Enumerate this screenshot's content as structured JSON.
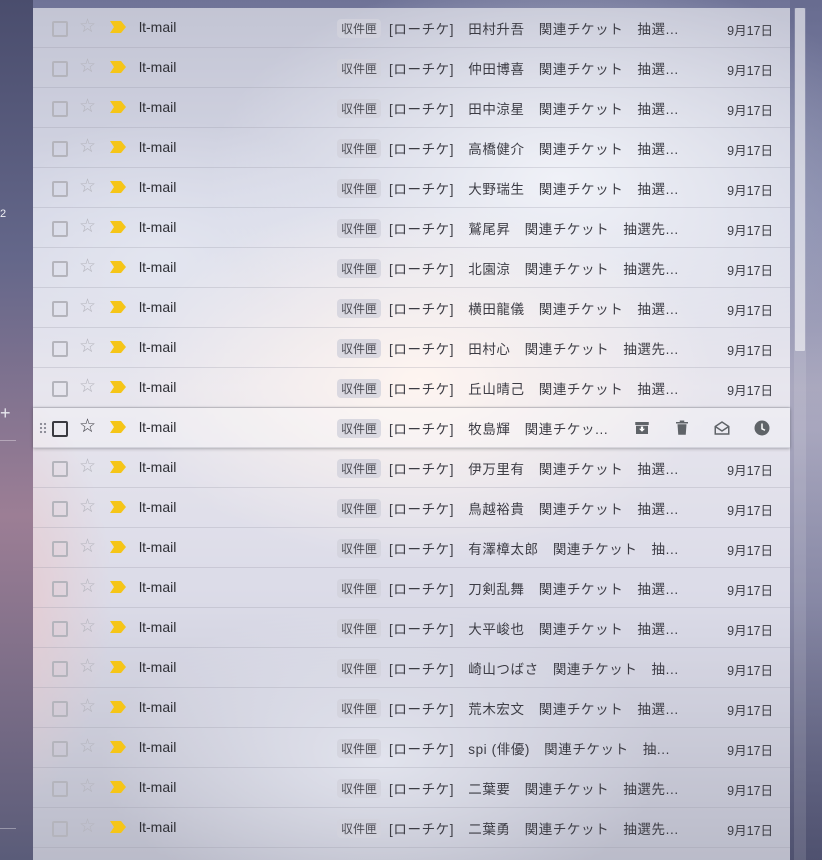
{
  "sidebar": {
    "count": "2",
    "add_symbol": "+"
  },
  "actions": {
    "archive": "archive-icon",
    "delete": "trash-icon",
    "mark_read": "mark-as-read-icon",
    "snooze": "clock-icon"
  },
  "colors": {
    "important_marker": "#f5c518",
    "hover_icon": "#5f6368"
  },
  "emails": [
    {
      "sender": "lt-mail",
      "label": "収件匣",
      "subject": "[ローチケ]　田村升吾　関連チケット　抽選...",
      "date": "9月17日"
    },
    {
      "sender": "lt-mail",
      "label": "収件匣",
      "subject": "[ローチケ]　仲田博喜　関連チケット　抽選...",
      "date": "9月17日"
    },
    {
      "sender": "lt-mail",
      "label": "収件匣",
      "subject": "[ローチケ]　田中涼星　関連チケット　抽選...",
      "date": "9月17日"
    },
    {
      "sender": "lt-mail",
      "label": "収件匣",
      "subject": "[ローチケ]　高橋健介　関連チケット　抽選...",
      "date": "9月17日"
    },
    {
      "sender": "lt-mail",
      "label": "収件匣",
      "subject": "[ローチケ]　大野瑞生　関連チケット　抽選...",
      "date": "9月17日"
    },
    {
      "sender": "lt-mail",
      "label": "収件匣",
      "subject": "[ローチケ]　鷲尾昇　関連チケット　抽選先...",
      "date": "9月17日"
    },
    {
      "sender": "lt-mail",
      "label": "収件匣",
      "subject": "[ローチケ]　北園涼　関連チケット　抽選先...",
      "date": "9月17日"
    },
    {
      "sender": "lt-mail",
      "label": "収件匣",
      "subject": "[ローチケ]　横田龍儀　関連チケット　抽選...",
      "date": "9月17日"
    },
    {
      "sender": "lt-mail",
      "label": "収件匣",
      "subject": "[ローチケ]　田村心　関連チケット　抽選先...",
      "date": "9月17日"
    },
    {
      "sender": "lt-mail",
      "label": "収件匣",
      "subject": "[ローチケ]　丘山晴己　関連チケット　抽選...",
      "date": "9月17日"
    },
    {
      "sender": "lt-mail",
      "label": "収件匣",
      "subject": "[ローチケ]　牧島輝　関連チケッ...",
      "date": "",
      "hover": true
    },
    {
      "sender": "lt-mail",
      "label": "収件匣",
      "subject": "[ローチケ]　伊万里有　関連チケット　抽選...",
      "date": "9月17日"
    },
    {
      "sender": "lt-mail",
      "label": "収件匣",
      "subject": "[ローチケ]　鳥越裕貴　関連チケット　抽選...",
      "date": "9月17日"
    },
    {
      "sender": "lt-mail",
      "label": "収件匣",
      "subject": "[ローチケ]　有澤樟太郎　関連チケット　抽...",
      "date": "9月17日"
    },
    {
      "sender": "lt-mail",
      "label": "収件匣",
      "subject": "[ローチケ]　刀剣乱舞　関連チケット　抽選...",
      "date": "9月17日"
    },
    {
      "sender": "lt-mail",
      "label": "収件匣",
      "subject": "[ローチケ]　大平峻也　関連チケット　抽選...",
      "date": "9月17日"
    },
    {
      "sender": "lt-mail",
      "label": "収件匣",
      "subject": "[ローチケ]　崎山つばさ　関連チケット　抽...",
      "date": "9月17日"
    },
    {
      "sender": "lt-mail",
      "label": "収件匣",
      "subject": "[ローチケ]　荒木宏文　関連チケット　抽選...",
      "date": "9月17日"
    },
    {
      "sender": "lt-mail",
      "label": "収件匣",
      "subject": "[ローチケ]　spi (俳優)　関連チケット　抽...",
      "date": "9月17日"
    },
    {
      "sender": "lt-mail",
      "label": "収件匣",
      "subject": "[ローチケ]　二葉要　関連チケット　抽選先...",
      "date": "9月17日"
    },
    {
      "sender": "lt-mail",
      "label": "収件匣",
      "subject": "[ローチケ]　二葉勇　関連チケット　抽選先...",
      "date": "9月17日"
    }
  ]
}
